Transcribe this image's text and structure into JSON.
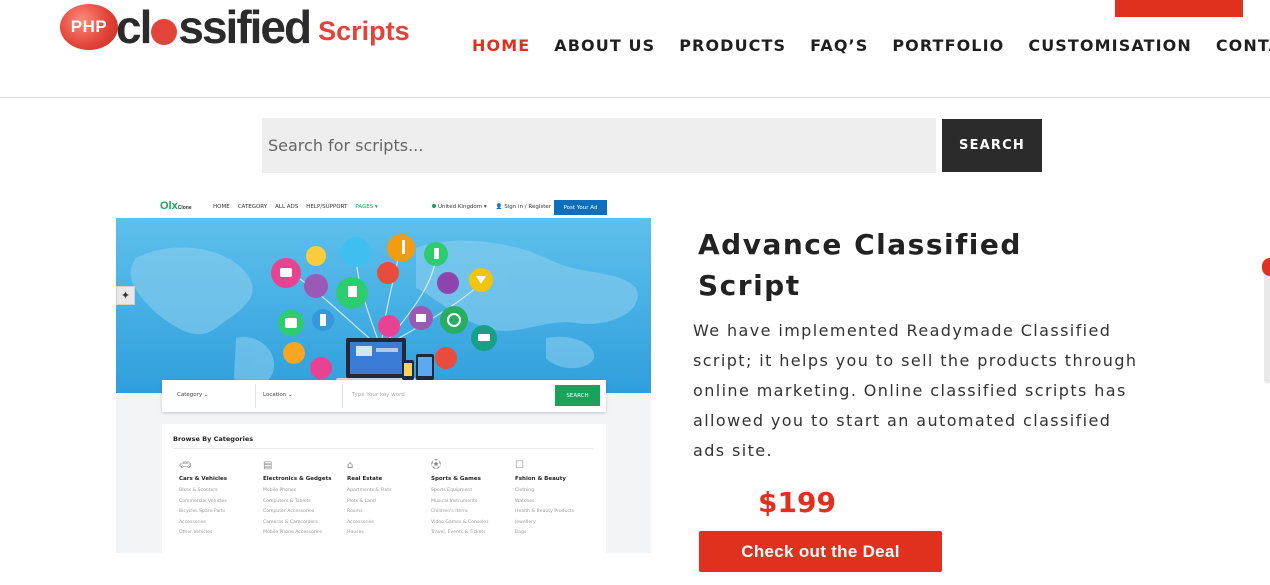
{
  "brand": {
    "badge_text": "PHP",
    "word_start": "cl",
    "word_end": "ssified",
    "suffix": "Scripts",
    "accent_color": "#e0301e"
  },
  "nav": {
    "items": [
      {
        "label": "HOME",
        "active": true
      },
      {
        "label": "ABOUT US",
        "active": false
      },
      {
        "label": "PRODUCTS",
        "active": false
      },
      {
        "label": "FAQ’S",
        "active": false
      },
      {
        "label": "PORTFOLIO",
        "active": false
      },
      {
        "label": "CUSTOMISATION",
        "active": false
      },
      {
        "label": "CONTACT",
        "active": false
      }
    ]
  },
  "search": {
    "placeholder": "Search for scripts...",
    "button_label": "SEARCH"
  },
  "preview": {
    "logo_main": "Olx",
    "logo_small": "Clone",
    "nav_links": [
      "HOME",
      "CATEGORY",
      "ALL ADS",
      "HELP/SUPPORT",
      "PAGES ▾"
    ],
    "country": "United Kingdom ▾",
    "signin": "Sign in / Register",
    "post_button": "Post Your Ad",
    "searchbar": {
      "category": "Category ⌄",
      "location": "Location ⌄",
      "keyword_placeholder": "Type Your key word",
      "button": "SEARCH"
    },
    "categories_title": "Browse By Categories",
    "categories": [
      {
        "icon": "car-icon",
        "title": "Cars & Vehicles",
        "items": [
          "Bikes & Scooters",
          "Commercial Vehicles",
          "Bicycles Spare Parts",
          "Accessories",
          "Other Vehicles"
        ]
      },
      {
        "icon": "electronics-icon",
        "title": "Electronics & Gedgets",
        "items": [
          "Mobile Phones",
          "Computers & Tablets",
          "Computer Accessories",
          "Cameras & Camcorders",
          "Mobile Phone Accessories"
        ]
      },
      {
        "icon": "real-estate-icon",
        "title": "Real Estate",
        "items": [
          "Apartments & Flats",
          "Plots & Land",
          "Rooms",
          "Accessories",
          "Houses"
        ]
      },
      {
        "icon": "sports-icon",
        "title": "Sports & Games",
        "items": [
          "Sports Equipment",
          "Musical Instruments",
          "Children's Items",
          "Video Games & Consoles",
          "Travel, Events & Tickets"
        ]
      },
      {
        "icon": "fashion-icon",
        "title": "Fshion & Beauty",
        "items": [
          "Clothing",
          "Watches",
          "Health & Beauty Products",
          "Jewellery",
          "Bags"
        ]
      }
    ]
  },
  "product": {
    "title": "Advance Classified Script",
    "description": "We have implemented Readymade Classified script; it helps you to sell the products through online marketing. Online classified scripts has allowed you to start an automated classified ads site.",
    "price": "$199",
    "cta_label": "Check out the Deal"
  }
}
